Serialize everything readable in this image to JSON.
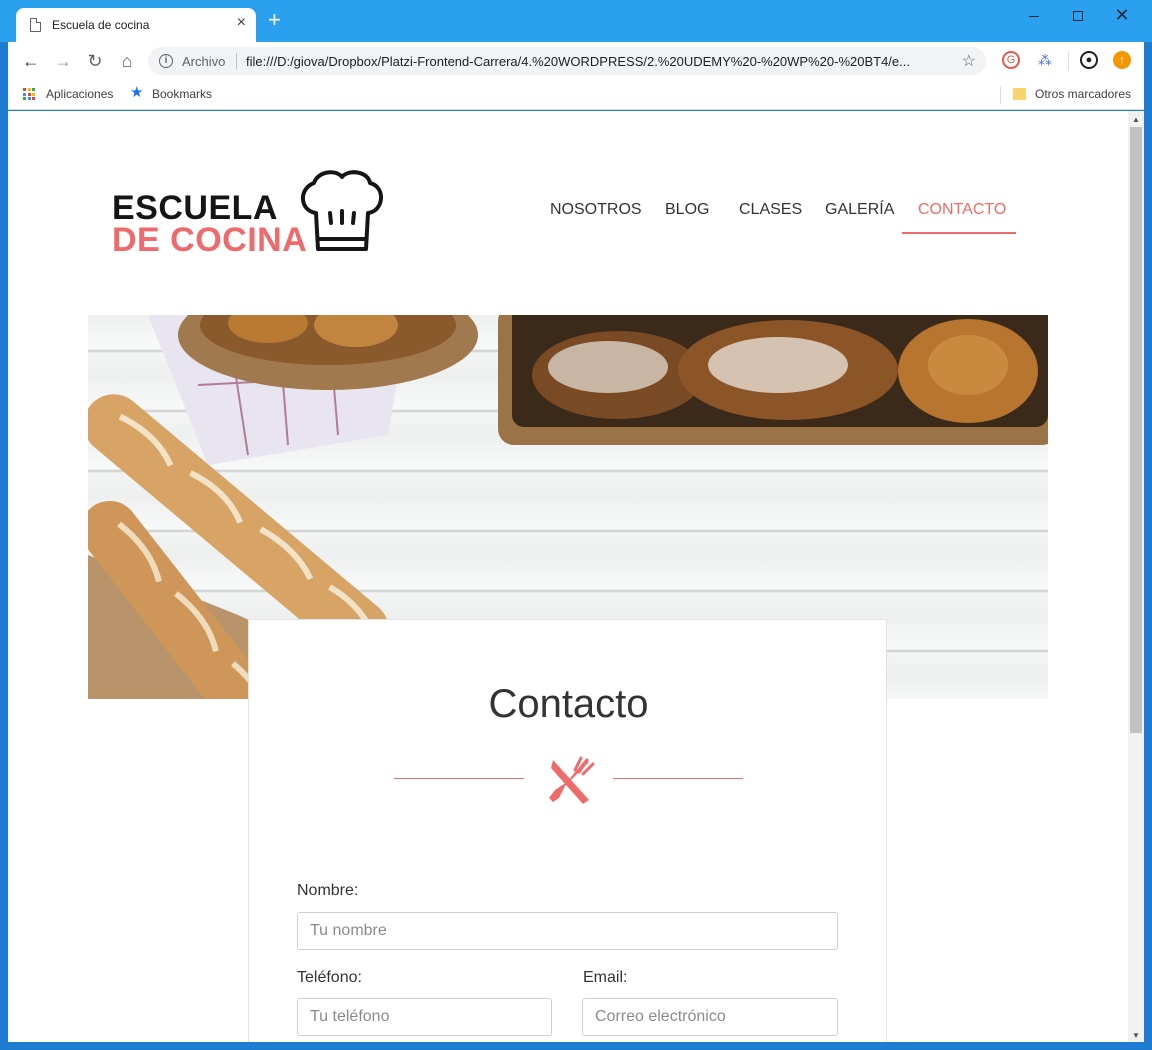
{
  "browser": {
    "tab_title": "Escuela de cocina",
    "tab_close": "×",
    "new_tab": "+",
    "address_label": "Archivo",
    "url": "file:///D:/giova/Dropbox/Platzi-Frontend-Carrera/4.%20WORDPRESS/2.%20UDEMY%20-%20WP%20-%20BT4/e...",
    "bookmarks": {
      "apps": "Aplicaciones",
      "bookmarks": "Bookmarks",
      "other": "Otros marcadores"
    }
  },
  "site": {
    "logo": {
      "line1": "ESCUELA",
      "line2": "DE COCINA"
    },
    "nav": [
      {
        "label": "NOSOTROS",
        "active": false
      },
      {
        "label": "BLOG",
        "active": false
      },
      {
        "label": "CLASES",
        "active": false
      },
      {
        "label": "GALERÍA",
        "active": false
      },
      {
        "label": "CONTACTO",
        "active": true
      }
    ]
  },
  "contact": {
    "title": "Contacto",
    "fields": {
      "nombre": {
        "label": "Nombre:",
        "placeholder": "Tu nombre"
      },
      "telefono": {
        "label": "Teléfono:",
        "placeholder": "Tu teléfono"
      },
      "email": {
        "label": "Email:",
        "placeholder": "Correo electrónico"
      }
    }
  },
  "colors": {
    "accent": "#ef6a6b",
    "titlebar": "#2aa0ee",
    "text": "#333333"
  }
}
